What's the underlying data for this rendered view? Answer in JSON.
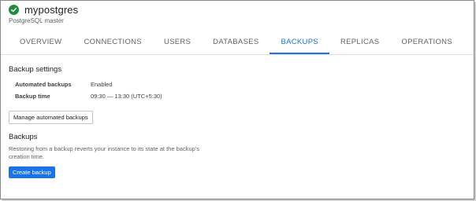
{
  "instance": {
    "name": "mypostgres",
    "subtitle": "PostgreSQL master",
    "status_icon": "check-circle-icon",
    "status_color": "#1e8e3e"
  },
  "tabs": [
    {
      "label": "OVERVIEW",
      "active": false
    },
    {
      "label": "CONNECTIONS",
      "active": false
    },
    {
      "label": "USERS",
      "active": false
    },
    {
      "label": "DATABASES",
      "active": false
    },
    {
      "label": "BACKUPS",
      "active": true
    },
    {
      "label": "REPLICAS",
      "active": false
    },
    {
      "label": "OPERATIONS",
      "active": false
    }
  ],
  "backup_settings": {
    "title": "Backup settings",
    "rows": [
      {
        "label": "Automated backups",
        "value": "Enabled"
      },
      {
        "label": "Backup time",
        "value": "09:30 — 13:30 (UTC+5:30)"
      }
    ],
    "manage_button": "Manage automated backups"
  },
  "backups": {
    "title": "Backups",
    "description": "Restoring from a backup reverts your instance to its state at the backup's creation time.",
    "create_button": "Create backup"
  },
  "colors": {
    "accent": "#1a73e8",
    "success": "#1e8e3e"
  }
}
